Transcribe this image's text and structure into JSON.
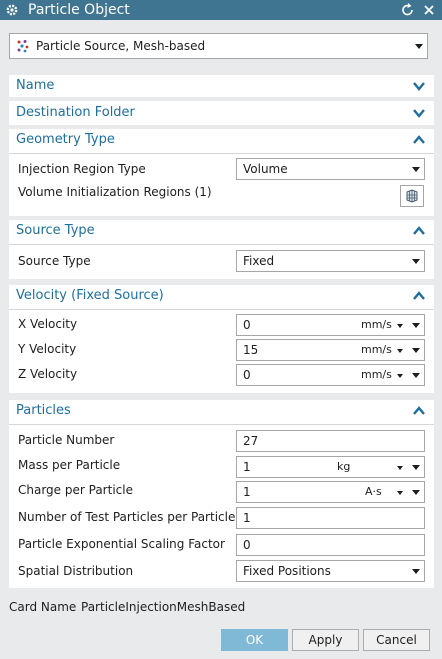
{
  "window": {
    "title": "Particle Object",
    "icons": [
      "gear-icon",
      "reset-icon",
      "close-icon"
    ]
  },
  "object_type": {
    "value": "Particle Source, Mesh-based",
    "icon": "particle-source-icon"
  },
  "sections": {
    "name": {
      "title": "Name",
      "state": "collapsed"
    },
    "destination": {
      "title": "Destination Folder",
      "state": "collapsed"
    },
    "geometry": {
      "title": "Geometry Type",
      "state": "expanded",
      "injection_label": "Injection Region Type",
      "injection_value": "Volume",
      "regions_label": "Volume Initialization Regions (1)",
      "regions_icon": "region-select-icon"
    },
    "source": {
      "title": "Source Type",
      "state": "expanded",
      "label": "Source Type",
      "value": "Fixed"
    },
    "velocity": {
      "title": "Velocity (Fixed Source)",
      "state": "expanded",
      "x_label": "X Velocity",
      "x_value": "0",
      "x_unit": "mm/s",
      "y_label": "Y Velocity",
      "y_value": "15",
      "y_unit": "mm/s",
      "z_label": "Z Velocity",
      "z_value": "0",
      "z_unit": "mm/s"
    },
    "particles": {
      "title": "Particles",
      "state": "expanded",
      "number_label": "Particle Number",
      "number_value": "27",
      "mass_label": "Mass per Particle",
      "mass_value": "1",
      "mass_unit": "kg",
      "charge_label": "Charge per Particle",
      "charge_value": "1",
      "charge_unit": "A·s",
      "test_label": "Number of Test Particles per Particle",
      "test_value": "1",
      "scaling_label": "Particle Exponential Scaling Factor",
      "scaling_value": "0",
      "spatial_label": "Spatial Distribution",
      "spatial_value": "Fixed Positions"
    }
  },
  "card": {
    "label": "Card Name",
    "value": "ParticleInjectionMeshBased"
  },
  "buttons": {
    "ok": "OK",
    "apply": "Apply",
    "cancel": "Cancel"
  },
  "colors": {
    "titlebar": "#3f7591",
    "section_title": "#1f6e9a",
    "ok_button": "#7fb9d5",
    "background": "#e9eaec"
  }
}
